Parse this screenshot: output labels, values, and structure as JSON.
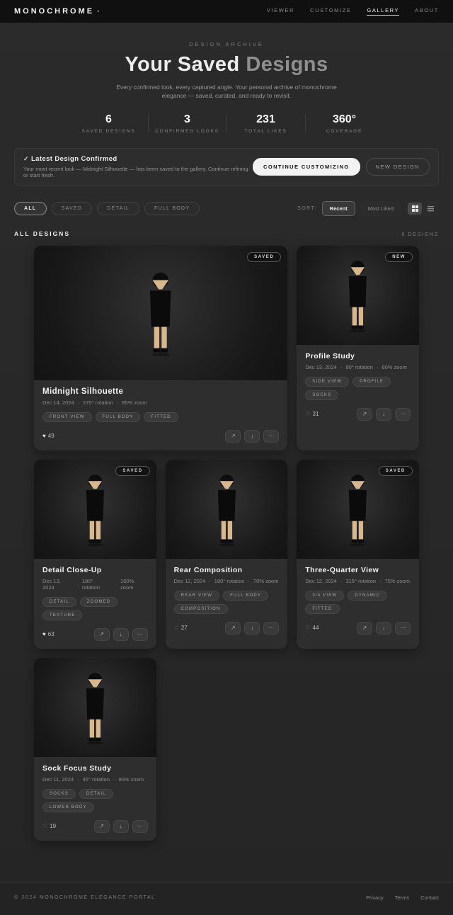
{
  "header": {
    "logo": "MONOCHROME",
    "logo_dot": "•",
    "nav": [
      {
        "label": "VIEWER",
        "active": false
      },
      {
        "label": "CUSTOMIZE",
        "active": false
      },
      {
        "label": "GALLERY",
        "active": true
      },
      {
        "label": "ABOUT",
        "active": false
      }
    ]
  },
  "hero": {
    "eyebrow": "DESIGN ARCHIVE",
    "title_primary": "Your Saved ",
    "title_secondary": "Designs",
    "subtitle": "Every confirmed look, every captured angle. Your personal archive of monochrome elegance — saved, curated, and ready to revisit."
  },
  "stats": [
    {
      "value": "6",
      "label": "SAVED DESIGNS"
    },
    {
      "value": "3",
      "label": "CONFIRMED LOOKS"
    },
    {
      "value": "231",
      "label": "TOTAL LIKES"
    },
    {
      "value": "360°",
      "label": "COVERAGE"
    }
  ],
  "banner": {
    "check_icon": "✓",
    "title": "Latest Design Confirmed",
    "subtitle": "Your most recent look — Midnight Silhouette — has been saved to the gallery. Continue refining or start fresh.",
    "primary_button": "CONTINUE CUSTOMIZING",
    "secondary_button": "NEW DESIGN"
  },
  "filters": {
    "pills": [
      {
        "label": "ALL",
        "active": true
      },
      {
        "label": "SAVED",
        "active": false
      },
      {
        "label": "DETAIL",
        "active": false
      },
      {
        "label": "FULL BODY",
        "active": false
      }
    ],
    "sort_label": "SORT:",
    "sort_options": [
      {
        "label": "Recent",
        "active": true
      },
      {
        "label": "Most Liked",
        "active": false
      }
    ]
  },
  "section": {
    "title": "ALL DESIGNS",
    "count": "6 DESIGNS"
  },
  "meta_separator": "·",
  "icons": {
    "heart_filled": "♥",
    "heart_outline": "♡",
    "share": "↗",
    "download": "↓",
    "more": "⋯"
  },
  "cards": [
    {
      "badge": "SAVED",
      "size": "large",
      "title": "Midnight Silhouette",
      "date": "Dec 14, 2024",
      "rotation": "270° rotation",
      "zoom": "85% zoom",
      "tags": [
        "FRONT VIEW",
        "FULL BODY",
        "FITTED"
      ],
      "likes": "49",
      "liked": true
    },
    {
      "badge": "NEW",
      "size": "small",
      "title": "Profile Study",
      "date": "Dec 13, 2024",
      "rotation": "90° rotation",
      "zoom": "60% zoom",
      "tags": [
        "SIDE VIEW",
        "PROFILE",
        "SOCKS"
      ],
      "likes": "31",
      "liked": false
    },
    {
      "badge": "SAVED",
      "size": "small",
      "title": "Detail Close-Up",
      "date": "Dec 13, 2024",
      "rotation": "180° rotation",
      "zoom": "100% zoom",
      "tags": [
        "DETAIL",
        "ZOOMED",
        "TEXTURE"
      ],
      "likes": "63",
      "liked": true
    },
    {
      "badge": null,
      "size": "small",
      "title": "Rear Composition",
      "date": "Dec 12, 2024",
      "rotation": "180° rotation",
      "zoom": "70% zoom",
      "tags": [
        "REAR VIEW",
        "FULL BODY",
        "COMPOSITION"
      ],
      "likes": "27",
      "liked": false
    },
    {
      "badge": "SAVED",
      "size": "small",
      "title": "Three-Quarter View",
      "date": "Dec 12, 2024",
      "rotation": "315° rotation",
      "zoom": "75% zoom",
      "tags": [
        "3/4 VIEW",
        "DYNAMIC",
        "FITTED"
      ],
      "likes": "44",
      "liked": false
    },
    {
      "badge": null,
      "size": "small",
      "title": "Sock Focus Study",
      "date": "Dec 11, 2024",
      "rotation": "45° rotation",
      "zoom": "90% zoom",
      "tags": [
        "SOCKS",
        "DETAIL",
        "LOWER BODY"
      ],
      "likes": "19",
      "liked": false
    }
  ],
  "footer": {
    "copyright": "© 2024 MONOCHROME ELEGANCE PORTAL",
    "links": [
      "Privacy",
      "Terms",
      "Contact"
    ]
  },
  "colors": {
    "skin": "#d7b78d",
    "garment": "#0b0b0b",
    "page_bg": "#262626",
    "card_bg": "#2e2e2e"
  }
}
